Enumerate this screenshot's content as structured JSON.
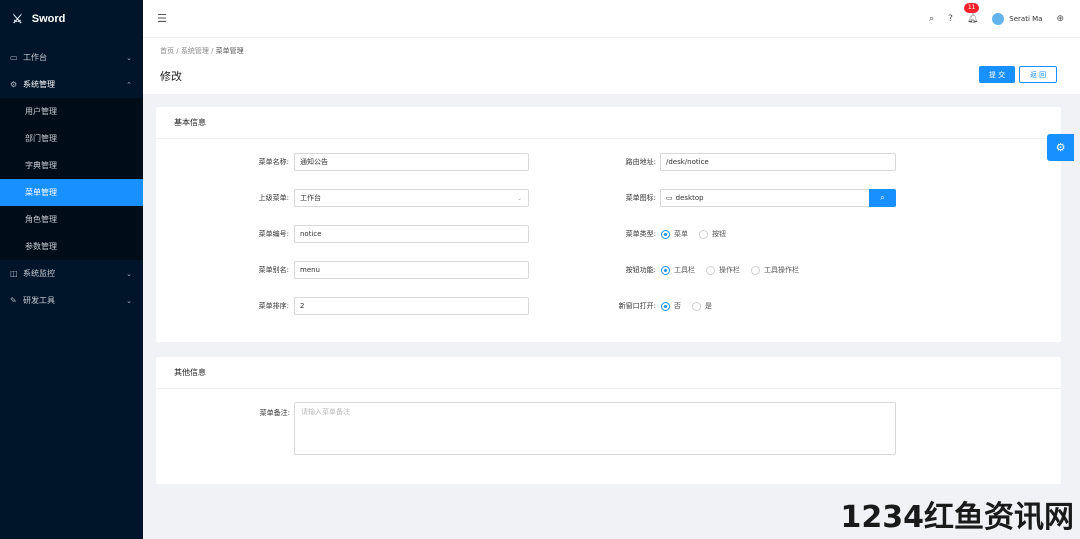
{
  "app": {
    "name": "Sword"
  },
  "sidebar": {
    "items": [
      {
        "label": "工作台",
        "icon": "monitor-icon"
      },
      {
        "label": "系统管理",
        "icon": "gear-icon"
      },
      {
        "label": "系统监控",
        "icon": "chart-icon"
      },
      {
        "label": "研发工具",
        "icon": "tool-icon"
      }
    ],
    "sub": [
      "用户管理",
      "部门管理",
      "字典管理",
      "菜单管理",
      "角色管理",
      "参数管理"
    ],
    "active": "菜单管理"
  },
  "topbar": {
    "notifications": "11",
    "user": "Serati Ma"
  },
  "breadcrumb": {
    "home": "首页",
    "sep": "/",
    "level1": "系统管理",
    "level2": "菜单管理"
  },
  "page": {
    "title": "修改",
    "submit": "提 交",
    "back": "返 回"
  },
  "basic": {
    "title": "基本信息",
    "name_label": "菜单名称:",
    "name_value": "通知公告",
    "route_label": "路由地址:",
    "route_value": "/desk/notice",
    "parent_label": "上级菜单:",
    "parent_value": "工作台",
    "icon_label": "菜单图标:",
    "icon_value": "desktop",
    "code_label": "菜单编号:",
    "code_value": "notice",
    "type_label": "菜单类型:",
    "type_options": [
      "菜单",
      "按钮"
    ],
    "type_selected": "菜单",
    "alias_label": "菜单别名:",
    "alias_value": "menu",
    "func_label": "按钮功能:",
    "func_options": [
      "工具栏",
      "操作栏",
      "工具操作栏"
    ],
    "func_selected": "工具栏",
    "order_label": "菜单排序:",
    "order_value": "2",
    "newwin_label": "新窗口打开:",
    "newwin_options": [
      "否",
      "是"
    ],
    "newwin_selected": "否"
  },
  "other": {
    "title": "其他信息",
    "remark_label": "菜单备注:",
    "remark_placeholder": "请输入菜单备注"
  },
  "watermark": "1234红鱼资讯网",
  "colors": {
    "primary": "#1890ff",
    "sidebar": "#001529"
  }
}
